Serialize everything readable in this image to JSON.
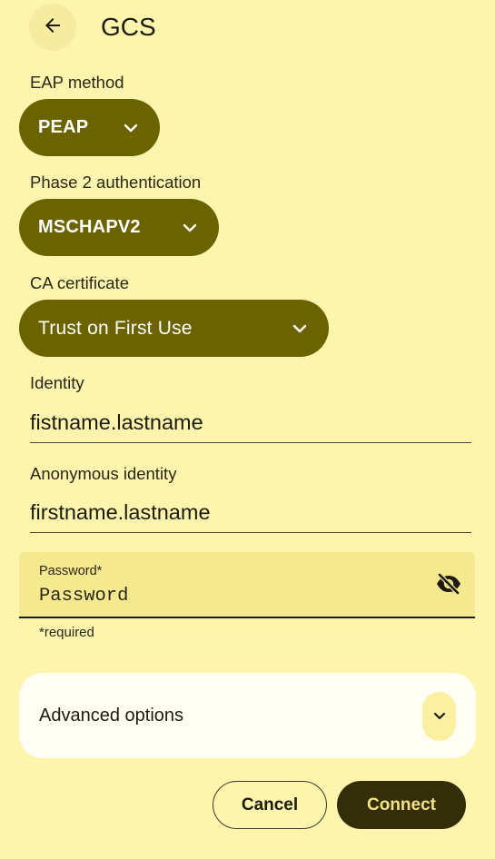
{
  "header": {
    "back_icon": "arrow-left-icon",
    "title": "GCS"
  },
  "eap_method": {
    "label": "EAP method",
    "value": "PEAP"
  },
  "phase2": {
    "label": "Phase 2 authentication",
    "value": "MSCHAPV2"
  },
  "ca_certificate": {
    "label": "CA certificate",
    "value": "Trust on First Use"
  },
  "identity": {
    "label": "Identity",
    "value": "fistname.lastname"
  },
  "anonymous_identity": {
    "label": "Anonymous identity",
    "value": "firstname.lastname"
  },
  "password": {
    "label": "Password*",
    "placeholder": "Password",
    "visibility_icon": "eye-off-icon",
    "helper": "*required"
  },
  "advanced": {
    "label": "Advanced options",
    "expand_icon": "chevron-down-icon"
  },
  "actions": {
    "cancel": "Cancel",
    "connect": "Connect"
  },
  "colors": {
    "background": "#fdf5ad",
    "pill": "#6b6200",
    "primary_button": "#342d09",
    "primary_button_text": "#f3e184"
  }
}
